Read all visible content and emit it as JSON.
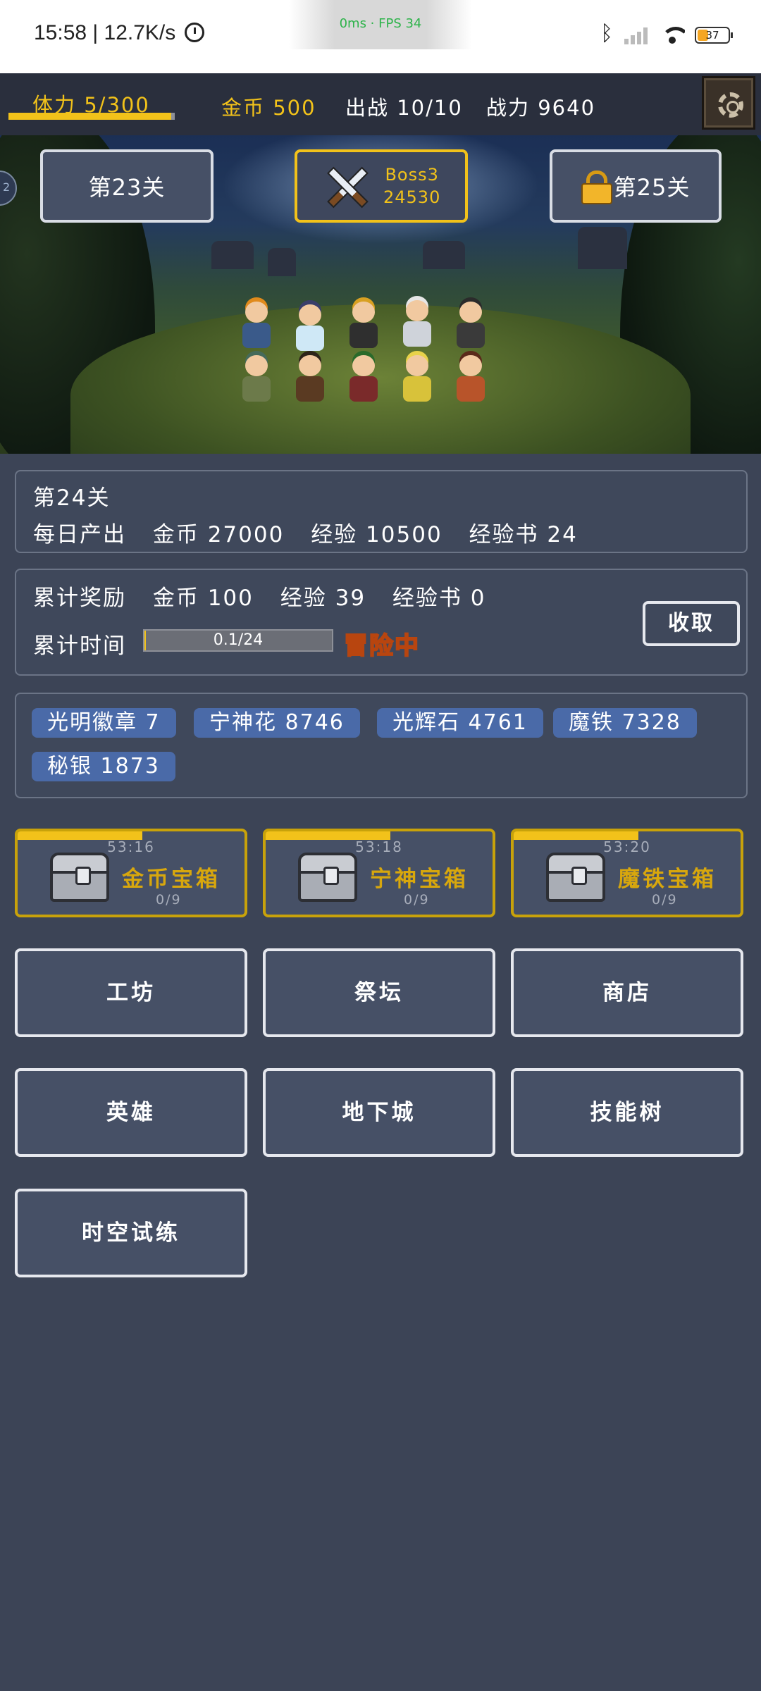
{
  "status_bar": {
    "time_speed": "15:58 | 12.7K/s",
    "perf": "0ms · FPS 34",
    "battery": "37",
    "icons": [
      "alarm-icon",
      "bluetooth-icon",
      "signal-icon",
      "wifi-icon",
      "battery-icon"
    ]
  },
  "top_bar": {
    "stamina": "体力 5/300",
    "stamina_fraction": 0.98,
    "gold": "金币 500",
    "deploy": "出战 10/10",
    "power": "战力 9640"
  },
  "scene": {
    "left_badge": "2",
    "prev_stage": "第23关",
    "boss_name": "Boss3",
    "boss_power": "24530",
    "next_stage": "第25关"
  },
  "stage_info": {
    "title": "第24关",
    "daily_label": "每日产出",
    "daily_gold": "金币 27000",
    "daily_exp": "经验 10500",
    "daily_book": "经验书 24"
  },
  "rewards": {
    "label": "累计奖励",
    "gold": "金币 100",
    "exp": "经验 39",
    "book": "经验书 0",
    "time_label": "累计时间",
    "progress_text": "0.1/24",
    "progress_fraction": 0.004,
    "status": "冒险中",
    "collect_label": "收取"
  },
  "resources": [
    "光明徽章 7",
    "宁神花 8746",
    "光辉石 4761",
    "魔铁 7328",
    "秘银 1873"
  ],
  "chests": [
    {
      "timer": "53:16",
      "name": "金币宝箱",
      "count": "0/9",
      "fraction": 0.55
    },
    {
      "timer": "53:18",
      "name": "宁神宝箱",
      "count": "0/9",
      "fraction": 0.55
    },
    {
      "timer": "53:20",
      "name": "魔铁宝箱",
      "count": "0/9",
      "fraction": 0.55
    }
  ],
  "menu": [
    "工坊",
    "祭坛",
    "商店",
    "英雄",
    "地下城",
    "技能树",
    "时空试练"
  ],
  "colors": {
    "accent": "#f2c21a",
    "background": "#3c4456",
    "chip": "#4a6aa8"
  }
}
